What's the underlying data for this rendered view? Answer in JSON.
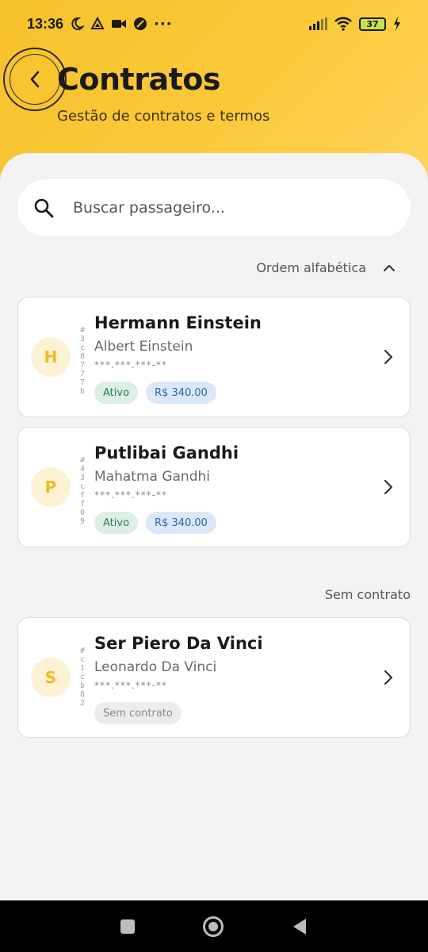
{
  "status_bar": {
    "time": "13:36",
    "battery_level": "37",
    "dots": "···",
    "icons": [
      "moon-icon",
      "drive-icon",
      "video-camera-icon",
      "data-saver-icon",
      "more-icon",
      "signal-icon",
      "wifi-icon",
      "battery-icon",
      "charging-icon"
    ]
  },
  "header": {
    "title": "Contratos",
    "subtitle": "Gestão de contratos e termos",
    "accent_color": "#f6c12a"
  },
  "search": {
    "placeholder": "Buscar passageiro..."
  },
  "sort": {
    "label": "Ordem alfabética"
  },
  "cards_contracts": [
    {
      "initial": "H",
      "id": "#3c8777b",
      "name": "Hermann Einstein",
      "passenger": "Albert Einstein",
      "document": "***.***.***-**",
      "status": "Ativo",
      "price": "R$ 340.00"
    },
    {
      "initial": "P",
      "id": "#43cff09",
      "name": "Putlibai Gandhi",
      "passenger": "Mahatma Gandhi",
      "document": "***.***.***-**",
      "status": "Ativo",
      "price": "R$ 340.00"
    }
  ],
  "section_no_contract": {
    "label": "Sem contrato"
  },
  "cards_no_contract": [
    {
      "initial": "S",
      "id": "#c1cb82",
      "name": "Ser Piero Da Vinci",
      "passenger": "Leonardo Da Vinci",
      "document": "***.***.***-**",
      "status": "Sem contrato"
    }
  ],
  "colors": {
    "active_badge_text": "#2e7a4a",
    "price_badge_text": "#2e65a8",
    "avatar_text": "#f0b92a"
  }
}
